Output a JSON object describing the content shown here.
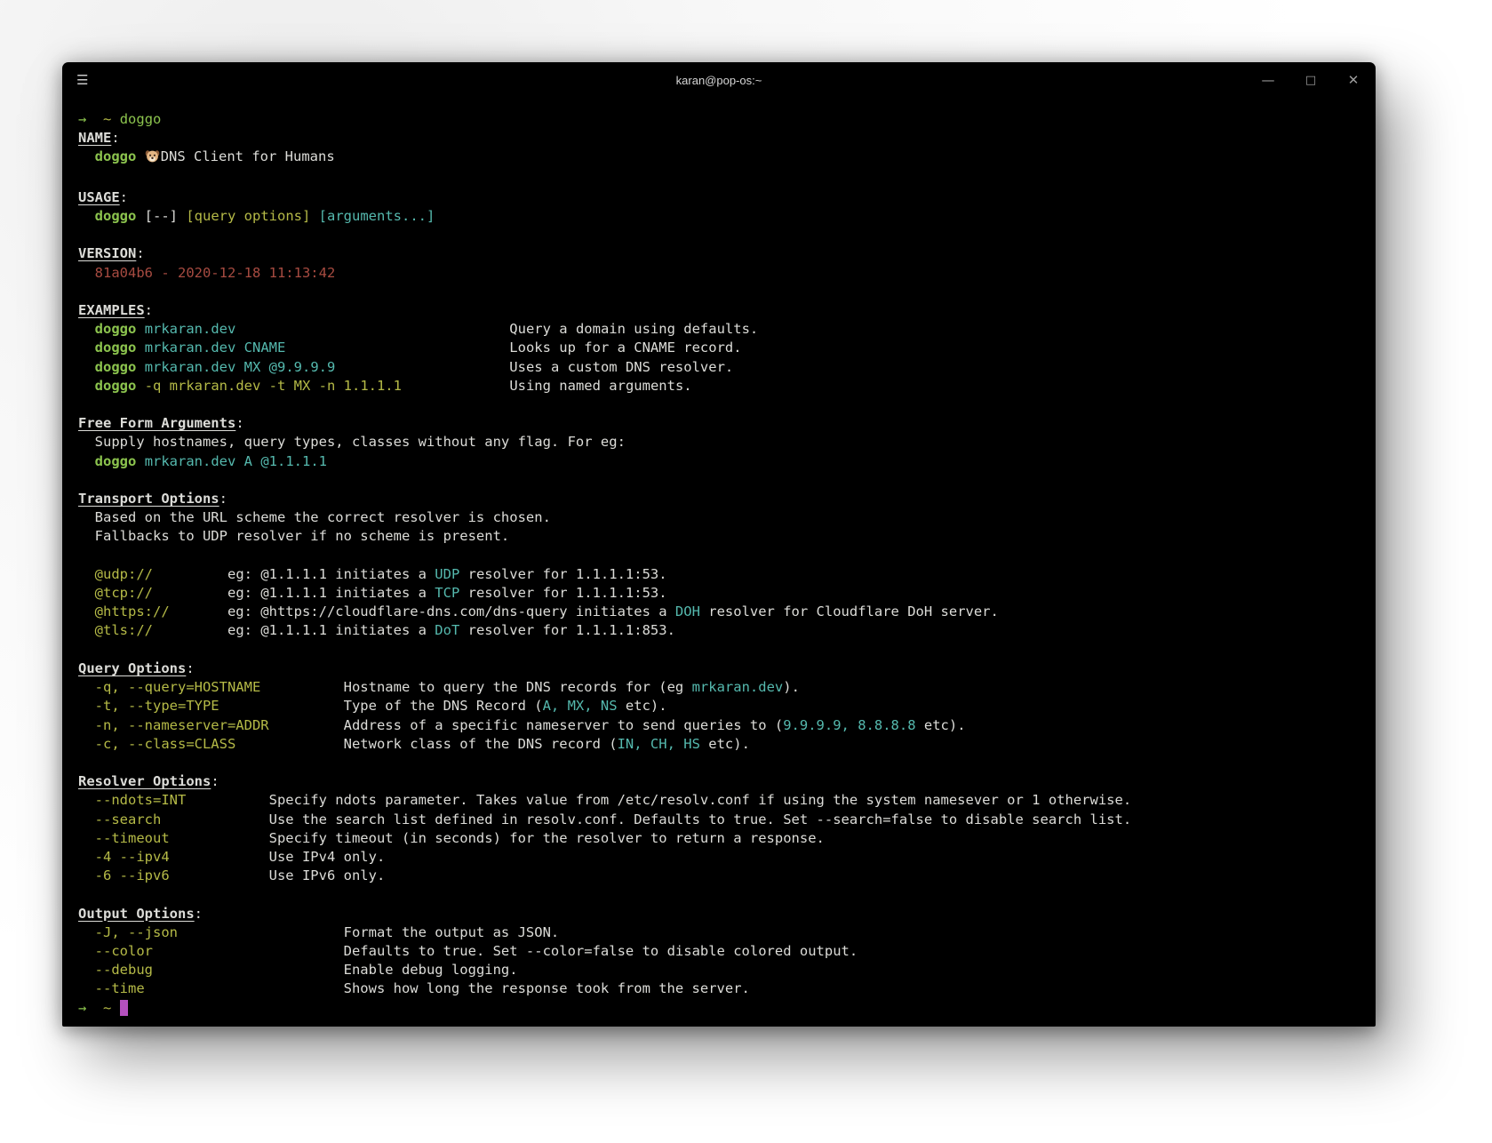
{
  "window": {
    "title": "karan@pop-os:~",
    "menu_icon": "☰",
    "controls": {
      "minimize": "—",
      "maximize": "□",
      "close": "✕"
    }
  },
  "colors": {
    "bg": "#000000",
    "fg": "#dcdcd8",
    "green": "#8cc44e",
    "yellow": "#b5ba47",
    "cyan": "#55b9ae",
    "red": "#a74b41",
    "magenta": "#b450be",
    "titlebar_fg": "#d6d6d6",
    "controls": "#9b9b9b"
  },
  "terminal": {
    "command": "doggo",
    "prompt_symbol": "→",
    "prompt_path": "~",
    "dog_emoji": "🐶",
    "lines": [
      [
        {
          "t": "→",
          "c": "g"
        },
        {
          "t": "  ",
          "c": "w"
        },
        {
          "t": "~",
          "c": "y"
        },
        {
          "t": " ",
          "c": "w"
        },
        {
          "t": "doggo",
          "c": "g"
        }
      ],
      [
        {
          "t": "NAME",
          "c": "h"
        },
        {
          "t": ":",
          "c": "w"
        }
      ],
      [
        {
          "t": "  ",
          "c": "w"
        },
        {
          "t": "doggo",
          "c": "gb"
        },
        {
          "t": " ",
          "c": "w"
        },
        {
          "t": "🐶",
          "c": "e"
        },
        {
          "t": "DNS Client for Humans",
          "c": "w"
        }
      ],
      [],
      [
        {
          "t": "USAGE",
          "c": "h"
        },
        {
          "t": ":",
          "c": "w"
        }
      ],
      [
        {
          "t": "  ",
          "c": "w"
        },
        {
          "t": "doggo",
          "c": "gb"
        },
        {
          "t": " [--] ",
          "c": "w"
        },
        {
          "t": "[query options]",
          "c": "y"
        },
        {
          "t": " ",
          "c": "w"
        },
        {
          "t": "[arguments...]",
          "c": "c"
        }
      ],
      [],
      [
        {
          "t": "VERSION",
          "c": "h"
        },
        {
          "t": ":",
          "c": "w"
        }
      ],
      [
        {
          "t": "  81a04b6 - 2020-12-18 11:13:42",
          "c": "r"
        }
      ],
      [],
      [
        {
          "t": "EXAMPLES",
          "c": "h"
        },
        {
          "t": ":",
          "c": "w"
        }
      ],
      [
        {
          "t": "  ",
          "c": "w"
        },
        {
          "t": "doggo",
          "c": "gb"
        },
        {
          "t": " ",
          "c": "w"
        },
        {
          "t": "mrkaran.dev",
          "c": "c"
        },
        {
          "t": "                                 ",
          "c": "w"
        },
        {
          "t": "Query a domain using defaults.",
          "c": "w"
        }
      ],
      [
        {
          "t": "  ",
          "c": "w"
        },
        {
          "t": "doggo",
          "c": "gb"
        },
        {
          "t": " ",
          "c": "w"
        },
        {
          "t": "mrkaran.dev CNAME",
          "c": "c"
        },
        {
          "t": "                           ",
          "c": "w"
        },
        {
          "t": "Looks up for a CNAME record.",
          "c": "w"
        }
      ],
      [
        {
          "t": "  ",
          "c": "w"
        },
        {
          "t": "doggo",
          "c": "gb"
        },
        {
          "t": " ",
          "c": "w"
        },
        {
          "t": "mrkaran.dev MX @9.9.9.9",
          "c": "c"
        },
        {
          "t": "                     ",
          "c": "w"
        },
        {
          "t": "Uses a custom DNS resolver.",
          "c": "w"
        }
      ],
      [
        {
          "t": "  ",
          "c": "w"
        },
        {
          "t": "doggo",
          "c": "gb"
        },
        {
          "t": " ",
          "c": "w"
        },
        {
          "t": "-q mrkaran.dev -t MX -n 1.1.1.1",
          "c": "y"
        },
        {
          "t": "             ",
          "c": "w"
        },
        {
          "t": "Using named arguments.",
          "c": "w"
        }
      ],
      [],
      [
        {
          "t": "Free Form Arguments",
          "c": "h"
        },
        {
          "t": ":",
          "c": "w"
        }
      ],
      [
        {
          "t": "  Supply hostnames, query types, classes without any flag. For eg:",
          "c": "w"
        }
      ],
      [
        {
          "t": "  ",
          "c": "w"
        },
        {
          "t": "doggo",
          "c": "gb"
        },
        {
          "t": " ",
          "c": "w"
        },
        {
          "t": "mrkaran.dev A @1.1.1.1",
          "c": "c"
        }
      ],
      [],
      [
        {
          "t": "Transport Options",
          "c": "h"
        },
        {
          "t": ":",
          "c": "w"
        }
      ],
      [
        {
          "t": "  Based on the URL scheme the correct resolver is chosen.",
          "c": "w"
        }
      ],
      [
        {
          "t": "  Fallbacks to UDP resolver if no scheme is present.",
          "c": "w"
        }
      ],
      [],
      [
        {
          "t": "  @udp://",
          "c": "y"
        },
        {
          "t": "         eg: @1.1.1.1 initiates a ",
          "c": "w"
        },
        {
          "t": "UDP",
          "c": "c"
        },
        {
          "t": " resolver for 1.1.1.1:53.",
          "c": "w"
        }
      ],
      [
        {
          "t": "  @tcp://",
          "c": "y"
        },
        {
          "t": "         eg: @1.1.1.1 initiates a ",
          "c": "w"
        },
        {
          "t": "TCP",
          "c": "c"
        },
        {
          "t": " resolver for 1.1.1.1:53.",
          "c": "w"
        }
      ],
      [
        {
          "t": "  @https://",
          "c": "y"
        },
        {
          "t": "       eg: @https://cloudflare-dns.com/dns-query initiates a ",
          "c": "w"
        },
        {
          "t": "DOH",
          "c": "c"
        },
        {
          "t": " resolver for Cloudflare DoH server.",
          "c": "w"
        }
      ],
      [
        {
          "t": "  @tls://",
          "c": "y"
        },
        {
          "t": "         eg: @1.1.1.1 initiates a ",
          "c": "w"
        },
        {
          "t": "DoT",
          "c": "c"
        },
        {
          "t": " resolver for 1.1.1.1:853.",
          "c": "w"
        }
      ],
      [],
      [
        {
          "t": "Query Options",
          "c": "h"
        },
        {
          "t": ":",
          "c": "w"
        }
      ],
      [
        {
          "t": "  -q, --query=HOSTNAME",
          "c": "y"
        },
        {
          "t": "          Hostname to query the DNS records for (eg ",
          "c": "w"
        },
        {
          "t": "mrkaran.dev",
          "c": "c"
        },
        {
          "t": ").",
          "c": "w"
        }
      ],
      [
        {
          "t": "  -t, --type=TYPE",
          "c": "y"
        },
        {
          "t": "               Type of the DNS Record (",
          "c": "w"
        },
        {
          "t": "A, MX, NS",
          "c": "c"
        },
        {
          "t": " etc).",
          "c": "w"
        }
      ],
      [
        {
          "t": "  -n, --nameserver=ADDR",
          "c": "y"
        },
        {
          "t": "         Address of a specific nameserver to send queries to (",
          "c": "w"
        },
        {
          "t": "9.9.9.9, 8.8.8.8",
          "c": "c"
        },
        {
          "t": " etc).",
          "c": "w"
        }
      ],
      [
        {
          "t": "  -c, --class=CLASS",
          "c": "y"
        },
        {
          "t": "             Network class of the DNS record (",
          "c": "w"
        },
        {
          "t": "IN, CH, HS",
          "c": "c"
        },
        {
          "t": " etc).",
          "c": "w"
        }
      ],
      [],
      [
        {
          "t": "Resolver Options",
          "c": "h"
        },
        {
          "t": ":",
          "c": "w"
        }
      ],
      [
        {
          "t": "  --ndots=INT",
          "c": "y"
        },
        {
          "t": "          Specify ndots parameter. Takes value from /etc/resolv.conf if using the system namesever or 1 otherwise.",
          "c": "w"
        }
      ],
      [
        {
          "t": "  --search",
          "c": "y"
        },
        {
          "t": "             Use the search list defined in resolv.conf. Defaults to true. Set --search=false to disable search list.",
          "c": "w"
        }
      ],
      [
        {
          "t": "  --timeout",
          "c": "y"
        },
        {
          "t": "            Specify timeout (in seconds) for the resolver to return a response.",
          "c": "w"
        }
      ],
      [
        {
          "t": "  -4 --ipv4",
          "c": "y"
        },
        {
          "t": "            Use IPv4 only.",
          "c": "w"
        }
      ],
      [
        {
          "t": "  -6 --ipv6",
          "c": "y"
        },
        {
          "t": "            Use IPv6 only.",
          "c": "w"
        }
      ],
      [],
      [
        {
          "t": "Output Options",
          "c": "h"
        },
        {
          "t": ":",
          "c": "w"
        }
      ],
      [
        {
          "t": "  -J, --json",
          "c": "y"
        },
        {
          "t": "                    Format the output as JSON.",
          "c": "w"
        }
      ],
      [
        {
          "t": "  --color",
          "c": "y"
        },
        {
          "t": "                       Defaults to true. Set --color=false to disable colored output.",
          "c": "w"
        }
      ],
      [
        {
          "t": "  --debug",
          "c": "y"
        },
        {
          "t": "                       Enable debug logging.",
          "c": "w"
        }
      ],
      [
        {
          "t": "  --time",
          "c": "y"
        },
        {
          "t": "                        Shows how long the response took from the server.",
          "c": "w"
        }
      ],
      [
        {
          "t": "→",
          "c": "g"
        },
        {
          "t": "  ",
          "c": "w"
        },
        {
          "t": "~",
          "c": "y"
        },
        {
          "t": " ",
          "c": "w"
        },
        {
          "t": " ",
          "c": "cur"
        }
      ]
    ]
  }
}
